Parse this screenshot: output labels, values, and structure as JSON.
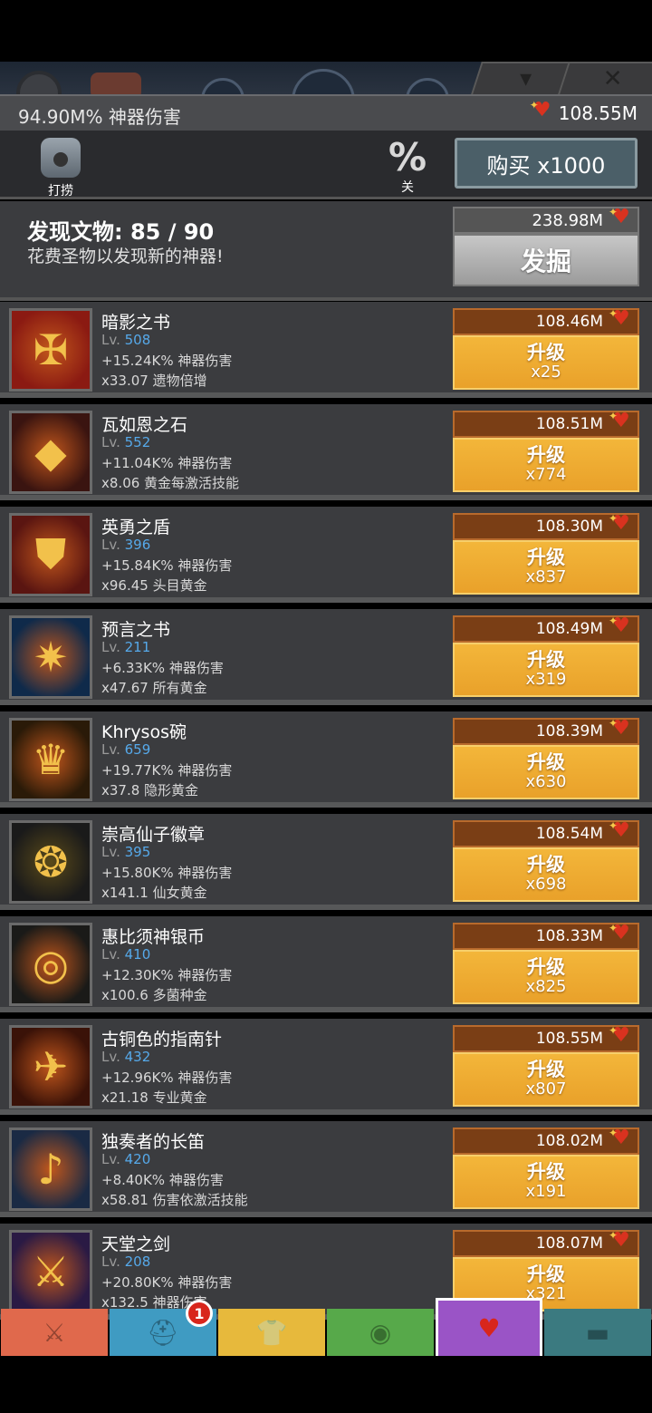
{
  "header": {
    "artifact_damage": "94.90M% 神器伤害",
    "relics_amount": "108.55M"
  },
  "controls": {
    "scavenge_label": "打捞",
    "percent_symbol": "%",
    "percent_label": "关",
    "buy_label": "购买 x1000"
  },
  "discover": {
    "title": "发现文物: 85 / 90",
    "subtitle": "花费圣物以发现新的神器!",
    "cost": "238.98M",
    "button_label": "发掘"
  },
  "artifacts": [
    {
      "name": "暗影之书",
      "level_prefix": "Lv.",
      "level": "508",
      "effect1": "+15.24K% 神器伤害",
      "effect2": "x33.07 遗物倍增",
      "cost": "108.46M",
      "upgrade_label": "升级",
      "upgrade_count": "x25",
      "icon": "book-of-shadows-icon",
      "color": "#8b1a12"
    },
    {
      "name": "瓦如恩之石",
      "level_prefix": "Lv.",
      "level": "552",
      "effect1": "+11.04K% 神器伤害",
      "effect2": "x8.06 黄金每激活技能",
      "cost": "108.51M",
      "upgrade_label": "升级",
      "upgrade_count": "x774",
      "icon": "stone-amulet-icon",
      "color": "#3a1410"
    },
    {
      "name": "英勇之盾",
      "level_prefix": "Lv.",
      "level": "396",
      "effect1": "+15.84K% 神器伤害",
      "effect2": "x96.45 头目黄金",
      "cost": "108.30M",
      "upgrade_label": "升级",
      "upgrade_count": "x837",
      "icon": "shield-icon",
      "color": "#5a1511"
    },
    {
      "name": "预言之书",
      "level_prefix": "Lv.",
      "level": "211",
      "effect1": "+6.33K% 神器伤害",
      "effect2": "x47.67 所有黄金",
      "cost": "108.49M",
      "upgrade_label": "升级",
      "upgrade_count": "x319",
      "icon": "book-of-prophecy-icon",
      "color": "#0f2a4a"
    },
    {
      "name": "Khrysos碗",
      "level_prefix": "Lv.",
      "level": "659",
      "effect1": "+19.77K% 神器伤害",
      "effect2": "x37.8 隐形黄金",
      "cost": "108.39M",
      "upgrade_label": "升级",
      "upgrade_count": "x630",
      "icon": "golden-bowl-icon",
      "color": "#2a1a08"
    },
    {
      "name": "崇高仙子徽章",
      "level_prefix": "Lv.",
      "level": "395",
      "effect1": "+15.80K% 神器伤害",
      "effect2": "x141.1 仙女黄金",
      "cost": "108.54M",
      "upgrade_label": "升级",
      "upgrade_count": "x698",
      "icon": "fairy-badge-icon",
      "color": "#1a1a1a"
    },
    {
      "name": "惠比须神银币",
      "level_prefix": "Lv.",
      "level": "410",
      "effect1": "+12.30K% 神器伤害",
      "effect2": "x100.6 多菌种金",
      "cost": "108.33M",
      "upgrade_label": "升级",
      "upgrade_count": "x825",
      "icon": "coins-icon",
      "color": "#1a1a18"
    },
    {
      "name": "古铜色的指南针",
      "level_prefix": "Lv.",
      "level": "432",
      "effect1": "+12.96K% 神器伤害",
      "effect2": "x21.18 专业黄金",
      "cost": "108.55M",
      "upgrade_label": "升级",
      "upgrade_count": "x807",
      "icon": "compass-icon",
      "color": "#3a1208"
    },
    {
      "name": "独奏者的长笛",
      "level_prefix": "Lv.",
      "level": "420",
      "effect1": "+8.40K% 神器伤害",
      "effect2": "x58.81 伤害依激活技能",
      "cost": "108.02M",
      "upgrade_label": "升级",
      "upgrade_count": "x191",
      "icon": "flute-icon",
      "color": "#1a2a44"
    },
    {
      "name": "天堂之剑",
      "level_prefix": "Lv.",
      "level": "208",
      "effect1": "+20.80K% 神器伤害",
      "effect2": "x132.5 神器伤害",
      "cost": "108.07M",
      "upgrade_label": "升级",
      "upgrade_count": "x321",
      "icon": "heavenly-sword-icon",
      "color": "#2a1a44"
    }
  ],
  "nav": {
    "tabs": [
      {
        "name": "sword-tab",
        "icon": "sword-icon",
        "color": "#e0694c"
      },
      {
        "name": "heroes-tab",
        "icon": "helmet-icon",
        "color": "#3f9bc2"
      },
      {
        "name": "equipment-tab",
        "icon": "shirt-icon",
        "color": "#e7b93c"
      },
      {
        "name": "pet-tab",
        "icon": "pet-icon",
        "color": "#57a94a"
      },
      {
        "name": "artifacts-tab",
        "icon": "winged-heart-icon",
        "color": "#9a54c6"
      },
      {
        "name": "shop-tab",
        "icon": "chest-icon",
        "color": "#3b7a80"
      }
    ],
    "badge_count": "1"
  }
}
